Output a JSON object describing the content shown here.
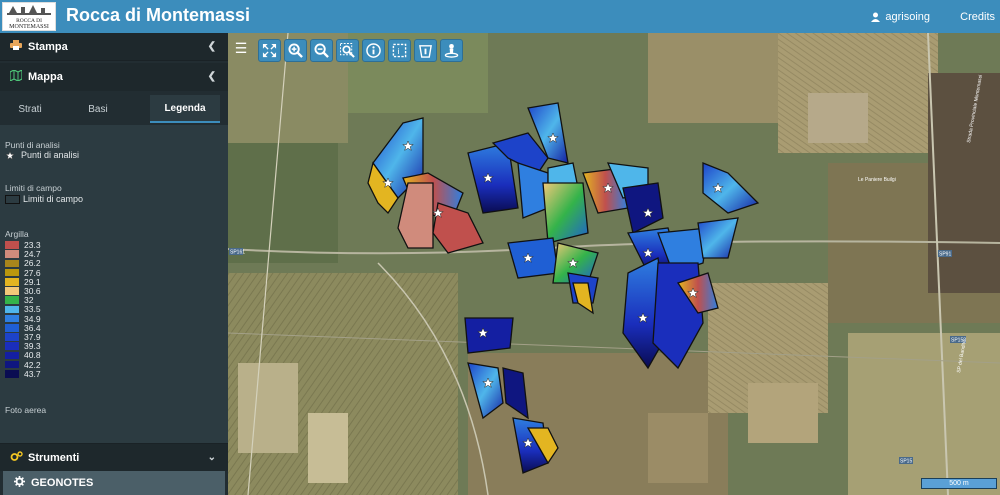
{
  "header": {
    "logo_line1": "ROCCA DI",
    "logo_line2": "MONTEMASSI",
    "title": "Rocca di Montemassi",
    "user": "agrisoing",
    "credits": "Credits"
  },
  "sidebar": {
    "stampa": "Stampa",
    "mappa": "Mappa",
    "tabs": [
      "Strati",
      "Basi",
      "Legenda"
    ],
    "active_tab": "Legenda",
    "legend": {
      "punti_title": "Punti di analisi",
      "punti_item": "Punti di analisi",
      "limiti_title": "Limiti di campo",
      "limiti_item": "Limiti di campo",
      "argilla_title": "Argilla",
      "argilla_classes": [
        {
          "label": "23.3",
          "color": "#c0504d"
        },
        {
          "label": "24.7",
          "color": "#d08b7c"
        },
        {
          "label": "26.2",
          "color": "#a8861c"
        },
        {
          "label": "27.6",
          "color": "#b9970e"
        },
        {
          "label": "29.1",
          "color": "#e3b521"
        },
        {
          "label": "30.6",
          "color": "#f2c879"
        },
        {
          "label": "32",
          "color": "#34b34a"
        },
        {
          "label": "33.5",
          "color": "#4fb6ea"
        },
        {
          "label": "34.9",
          "color": "#2f7fe0"
        },
        {
          "label": "36.4",
          "color": "#1f5fd4"
        },
        {
          "label": "37.9",
          "color": "#1d43c9"
        },
        {
          "label": "39.3",
          "color": "#1a2ebc"
        },
        {
          "label": "40.8",
          "color": "#141fa2"
        },
        {
          "label": "42.2",
          "color": "#0f1680"
        },
        {
          "label": "43.7",
          "color": "#0a0c52"
        }
      ],
      "foto_title": "Foto aerea"
    },
    "strumenti": "Strumenti",
    "geonotes": "GEONOTES"
  },
  "map": {
    "tools": [
      "fullscreen-icon",
      "zoom-in-icon",
      "zoom-out-icon",
      "zoom-box-icon",
      "info-icon",
      "select-box-icon",
      "clear-icon",
      "locate-icon"
    ],
    "scale": "500 m",
    "road_labels": [
      "SP161",
      "SP158",
      "SP91",
      "SP15",
      "Le Paniere Builgi",
      "Strada Provinciale Montemassi",
      "SP del Bandito"
    ]
  }
}
